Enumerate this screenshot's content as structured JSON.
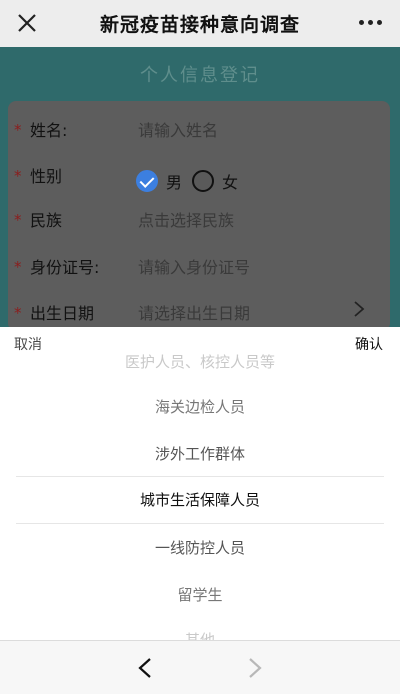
{
  "nav": {
    "title": "新冠疫苗接种意向调查",
    "close_icon": "close-icon",
    "more_icon": "more-icon"
  },
  "form": {
    "title": "个人信息登记",
    "fields": [
      {
        "label": "姓名:",
        "placeholder": "请输入姓名",
        "required": true
      },
      {
        "label": "性别",
        "required": true
      },
      {
        "label": "民族",
        "placeholder": "点击选择民族",
        "required": true
      },
      {
        "label": "身份证号:",
        "placeholder": "请输入身份证号",
        "required": true
      },
      {
        "label": "出生日期",
        "placeholder": "请选择出生日期",
        "required": true
      }
    ],
    "gender_options": [
      "男",
      "女"
    ],
    "gender_selected": "男"
  },
  "picker": {
    "cancel_label": "取消",
    "confirm_label": "确认",
    "options": [
      "医护人员、核控人员等",
      "海关边检人员",
      "涉外工作群体",
      "城市生活保障人员",
      "一线防控人员",
      "留学生",
      "其他"
    ],
    "selected": "城市生活保障人员"
  },
  "bottom_bar": {
    "back_icon": "chevron-left-icon",
    "forward_icon": "chevron-right-icon"
  },
  "colors": {
    "overlay": "#2f6a6b",
    "accent": "#3c7fe0",
    "required_star": "#8c1d1d"
  }
}
